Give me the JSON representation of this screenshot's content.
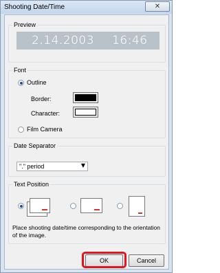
{
  "window": {
    "title": "Shooting Date/Time",
    "close_symbol": "✕"
  },
  "preview": {
    "label": "Preview",
    "date": "2.14.2003",
    "time": "16:46"
  },
  "font": {
    "label": "Font",
    "outline_label": "Outline",
    "outline_selected": true,
    "border_label": "Border:",
    "character_label": "Character:",
    "border_color": "#000000",
    "character_color": "#ffffff",
    "film_label": "Film Camera",
    "film_selected": false
  },
  "date_separator": {
    "label": "Date Separator",
    "value": "\".\" period"
  },
  "text_position": {
    "label": "Text Position",
    "selected_index": 0,
    "description": "Place shooting date/time corresponding to the orientation of the image."
  },
  "buttons": {
    "ok": "OK",
    "cancel": "Cancel"
  },
  "colors": {
    "highlight": "#e3141b",
    "radio_dot": "#1c4d9a",
    "stamp_marks": "#d9302c"
  }
}
